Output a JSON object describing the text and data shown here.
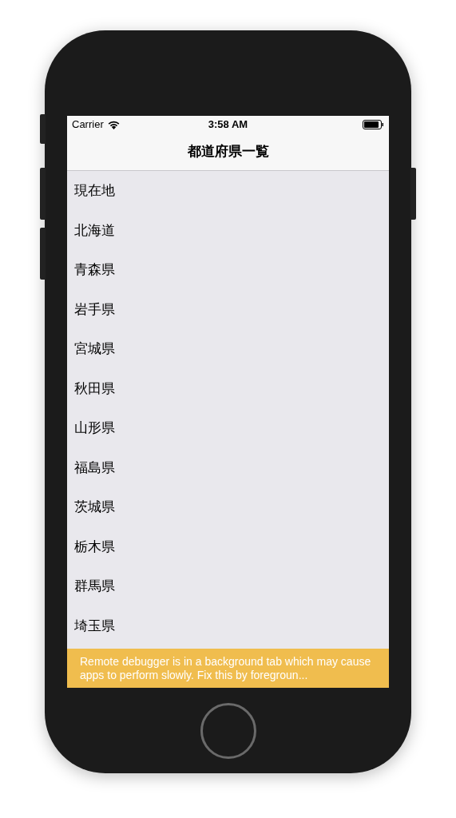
{
  "status_bar": {
    "carrier": "Carrier",
    "time": "3:58 AM"
  },
  "nav_bar": {
    "title": "都道府県一覧"
  },
  "list": {
    "items": [
      {
        "label": "現在地"
      },
      {
        "label": "北海道"
      },
      {
        "label": "青森県"
      },
      {
        "label": "岩手県"
      },
      {
        "label": "宮城県"
      },
      {
        "label": "秋田県"
      },
      {
        "label": "山形県"
      },
      {
        "label": "福島県"
      },
      {
        "label": "茨城県"
      },
      {
        "label": "栃木県"
      },
      {
        "label": "群馬県"
      },
      {
        "label": "埼玉県"
      }
    ]
  },
  "warning_banner": {
    "text": "Remote debugger is in a background tab which may cause apps to perform slowly. Fix this by foregroun..."
  }
}
